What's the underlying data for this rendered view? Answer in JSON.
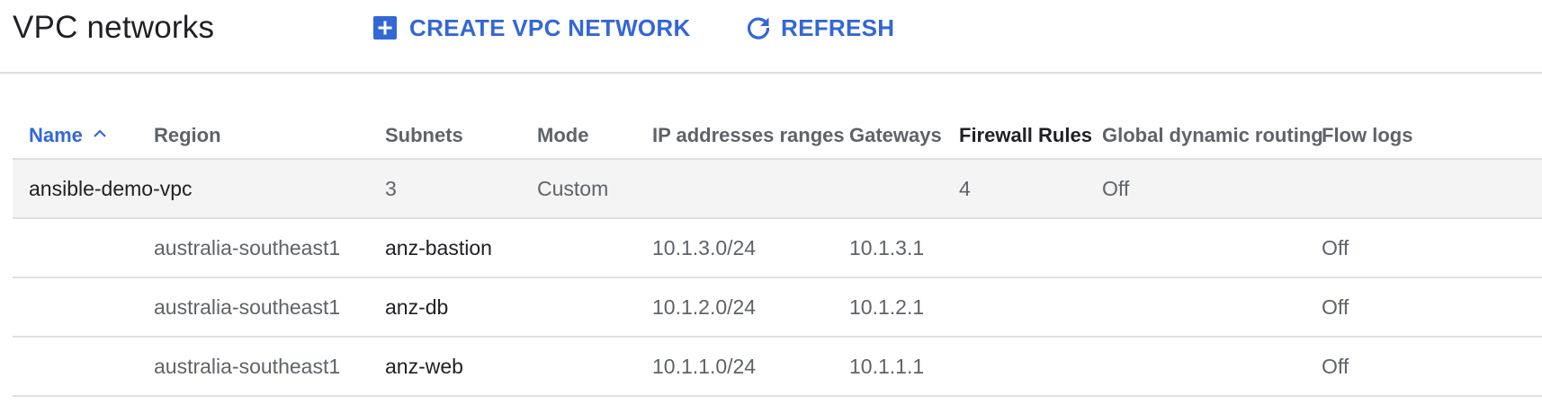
{
  "header": {
    "title": "VPC networks",
    "create_label": "CREATE VPC NETWORK",
    "refresh_label": "REFRESH"
  },
  "colors": {
    "accent": "#3367d6",
    "network_row_bg": "#f4f4f4"
  },
  "icons": {
    "create": "add-box-icon",
    "refresh": "refresh-icon",
    "sort": "chevron-up-icon"
  },
  "table": {
    "columns": {
      "name": "Name",
      "region": "Region",
      "subnets": "Subnets",
      "mode": "Mode",
      "ip_ranges": "IP addresses ranges",
      "gateways": "Gateways",
      "firewall_rules": "Firewall Rules",
      "global_dynamic_routing": "Global dynamic routing",
      "flow_logs": "Flow logs"
    },
    "sorted_column": "name",
    "sort_direction": "ascending",
    "network": {
      "name": "ansible-demo-vpc",
      "subnets": "3",
      "mode": "Custom",
      "firewall_rules": "4",
      "global_dynamic_routing": "Off"
    },
    "subnets": [
      {
        "region": "australia-southeast1",
        "name": "anz-bastion",
        "ip_range": "10.1.3.0/24",
        "gateway": "10.1.3.1",
        "flow_logs": "Off"
      },
      {
        "region": "australia-southeast1",
        "name": "anz-db",
        "ip_range": "10.1.2.0/24",
        "gateway": "10.1.2.1",
        "flow_logs": "Off"
      },
      {
        "region": "australia-southeast1",
        "name": "anz-web",
        "ip_range": "10.1.1.0/24",
        "gateway": "10.1.1.1",
        "flow_logs": "Off"
      }
    ]
  }
}
